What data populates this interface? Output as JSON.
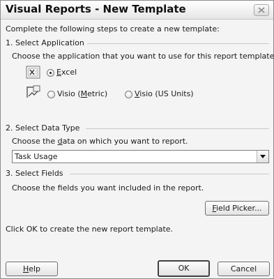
{
  "dialog": {
    "title": "Visual Reports - New Template",
    "intro": "Complete the following steps to create a new template:"
  },
  "step1": {
    "header": "1. Select Application",
    "instruction": "Choose the application that you want to use for this report template.",
    "options": [
      {
        "pre": "",
        "hot": "E",
        "post": "xcel",
        "selected": true,
        "icon": "excel-icon"
      },
      {
        "pre": "Visio (",
        "hot": "M",
        "post": "etric)",
        "selected": false,
        "icon": "visio-icon"
      },
      {
        "pre": "",
        "hot": "V",
        "post": "isio (US Units)",
        "selected": false,
        "icon": ""
      }
    ]
  },
  "step2": {
    "header": "2. Select Data Type",
    "instruction_pre": "Choose the ",
    "instruction_hot": "d",
    "instruction_post": "ata on which you want to report.",
    "selected_value": "Task Usage"
  },
  "step3": {
    "header": "3. Select Fields",
    "instruction": "Choose the fields you want included in the report.",
    "field_picker_hot": "F",
    "field_picker_rest": "ield Picker..."
  },
  "footer_note": "Click OK to create the new report template.",
  "buttons": {
    "help_hot": "H",
    "help_rest": "elp",
    "ok": "OK",
    "cancel": "Cancel"
  }
}
